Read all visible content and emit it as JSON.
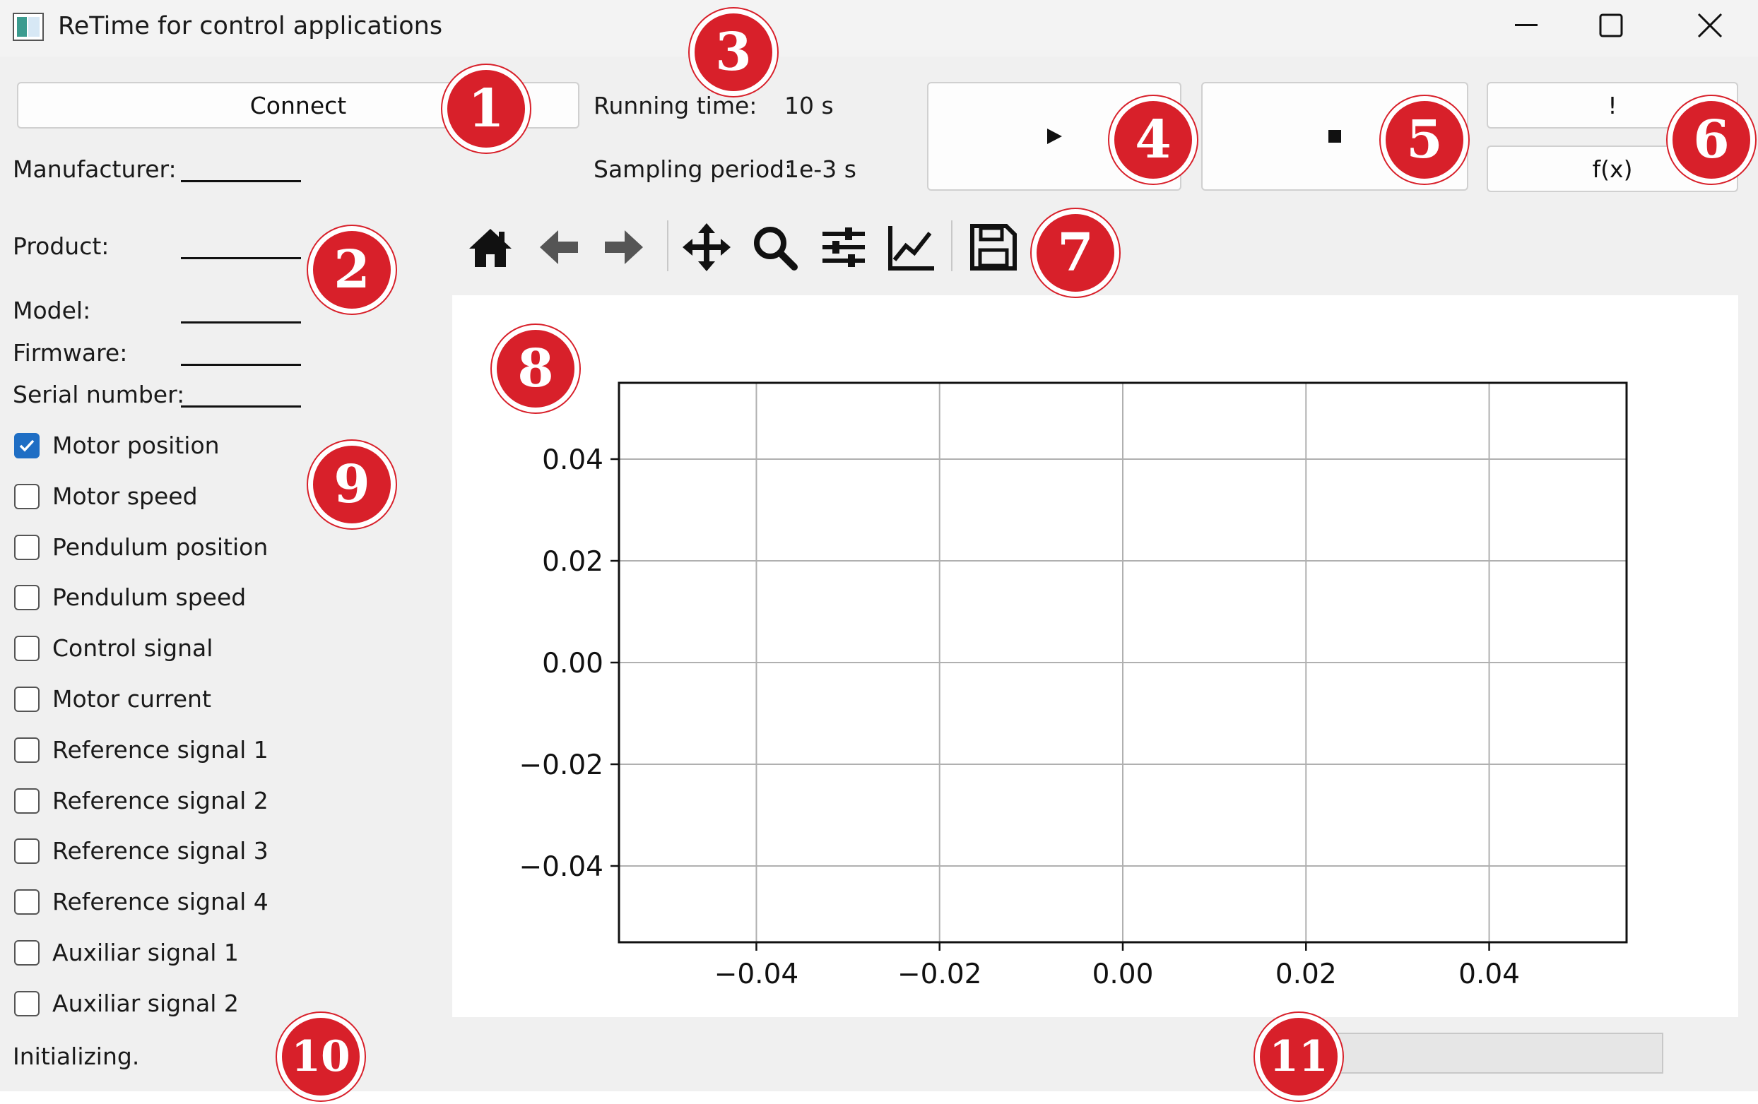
{
  "window": {
    "title": "ReTime for control applications"
  },
  "device": {
    "connect_label": "Connect",
    "fields": [
      {
        "label": "Manufacturer:"
      },
      {
        "label": "Product:"
      },
      {
        "label": "Model:"
      },
      {
        "label": "Firmware:"
      },
      {
        "label": "Serial number:"
      }
    ]
  },
  "timing": {
    "running_time_label": "Running time:",
    "running_time_value": "10 s",
    "sampling_period_label": "Sampling period:",
    "sampling_period_value": "1e-3 s"
  },
  "controls": {
    "play_icon": "play-icon",
    "stop_icon": "stop-icon",
    "alert_label": "!",
    "function_label": "f(x)"
  },
  "toolbar": {
    "icons": [
      "home-icon",
      "back-arrow-icon",
      "forward-arrow-icon",
      "pan-icon",
      "zoom-icon",
      "configure-subplots-icon",
      "edit-axes-icon",
      "save-icon"
    ]
  },
  "signals": [
    {
      "label": "Motor position",
      "checked": true
    },
    {
      "label": "Motor speed",
      "checked": false
    },
    {
      "label": "Pendulum position",
      "checked": false
    },
    {
      "label": "Pendulum speed",
      "checked": false
    },
    {
      "label": "Control signal",
      "checked": false
    },
    {
      "label": "Motor current",
      "checked": false
    },
    {
      "label": "Reference signal 1",
      "checked": false
    },
    {
      "label": "Reference signal 2",
      "checked": false
    },
    {
      "label": "Reference signal 3",
      "checked": false
    },
    {
      "label": "Reference signal 4",
      "checked": false
    },
    {
      "label": "Auxiliar signal 1",
      "checked": false
    },
    {
      "label": "Auxiliar signal 2",
      "checked": false
    }
  ],
  "status": {
    "text": "Initializing.",
    "progress": 0
  },
  "markers": [
    "1",
    "2",
    "3",
    "4",
    "5",
    "6",
    "7",
    "8",
    "9",
    "10",
    "11"
  ],
  "chart_data": {
    "type": "line",
    "series": [],
    "xlim": [
      -0.055,
      0.055
    ],
    "ylim": [
      -0.055,
      0.055
    ],
    "xticks": [
      "−0.04",
      "−0.02",
      "0.00",
      "0.02",
      "0.04"
    ],
    "yticks": [
      "0.04",
      "0.02",
      "0.00",
      "−0.02",
      "−0.04"
    ],
    "xtick_values": [
      -0.04,
      -0.02,
      0.0,
      0.02,
      0.04
    ],
    "ytick_values": [
      0.04,
      0.02,
      0.0,
      -0.02,
      -0.04
    ],
    "grid": true,
    "title": "",
    "xlabel": "",
    "ylabel": ""
  }
}
